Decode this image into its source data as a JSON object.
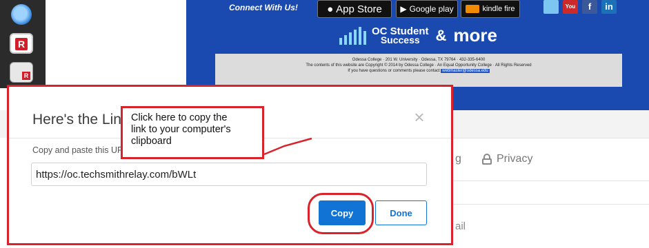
{
  "banner": {
    "connect_text": "Connect With Us!",
    "badges": {
      "app_store": "App Store",
      "google_play": "Google play",
      "kindle": "kindle fire"
    },
    "social_icons": [
      "twitter-icon",
      "youtube-icon",
      "facebook-icon",
      "linkedin-icon"
    ],
    "social_labels": {
      "youtube": "You",
      "facebook": "f",
      "linkedin": "in"
    },
    "brand": {
      "line1": "OC Student",
      "line2": "Success",
      "amp": "&",
      "more": "more"
    },
    "info_lines": [
      "Odessa College · 201 W. University · Odessa, TX 79764 · 432-335-6400",
      "The contents of this website are Copyright © 2014 by Odessa College · An Equal Opportunity College · All Rights Reserved",
      "If you have questions or comments please contact"
    ],
    "info_link": "webmaster@odessa.edu",
    "colors": {
      "banner_bg": "#1a49b0",
      "accent": "#8ad8ff"
    }
  },
  "background": {
    "partial_tab": "g",
    "privacy_tab": "Privacy",
    "partial_row": "ail"
  },
  "dialog": {
    "title": "Here's the Link",
    "close_symbol": "×",
    "description": "Copy and paste this URL to share media with viewers.",
    "url_value": "https://oc.techsmithrelay.com/bWLt",
    "copy_label": "Copy",
    "done_label": "Done",
    "colors": {
      "primary": "#1173d4",
      "annotation_red": "#d8232a"
    }
  },
  "callout": {
    "lines": [
      "Click here to copy the",
      "link to your computer's",
      "clipboard"
    ]
  }
}
